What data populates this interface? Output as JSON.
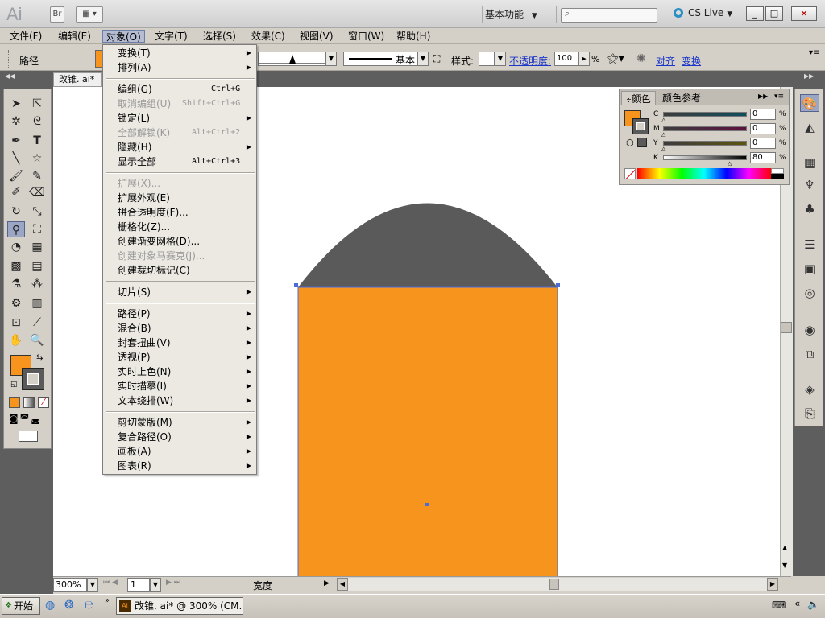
{
  "titlebar": {
    "app_logo": "Ai",
    "bridge_label": "Br",
    "workspace": "基本功能",
    "cs_live": "CS Live",
    "window_buttons": [
      "_",
      "□",
      "×"
    ]
  },
  "menubar": {
    "items": [
      "文件(F)",
      "编辑(E)",
      "对象(O)",
      "文字(T)",
      "选择(S)",
      "效果(C)",
      "视图(V)",
      "窗口(W)",
      "帮助(H)"
    ]
  },
  "controlbar": {
    "label": "路径",
    "stroke_profile": "基本",
    "style_label": "样式:",
    "opacity_label": "不透明度:",
    "opacity_value": "100",
    "opacity_unit": "%",
    "align_link": "对齐",
    "transform_link": "变换"
  },
  "document": {
    "tab": "改锥. ai*"
  },
  "object_menu": {
    "items": [
      {
        "label": "变换(T)",
        "shortcut": "",
        "submenu": true,
        "disabled": false
      },
      {
        "label": "排列(A)",
        "shortcut": "",
        "submenu": true,
        "disabled": false
      },
      {
        "label": "编组(G)",
        "shortcut": "Ctrl+G",
        "submenu": false,
        "disabled": false
      },
      {
        "label": "取消编组(U)",
        "shortcut": "Shift+Ctrl+G",
        "submenu": false,
        "disabled": true
      },
      {
        "label": "锁定(L)",
        "shortcut": "",
        "submenu": true,
        "disabled": false
      },
      {
        "label": "全部解锁(K)",
        "shortcut": "Alt+Ctrl+2",
        "submenu": false,
        "disabled": true
      },
      {
        "label": "隐藏(H)",
        "shortcut": "",
        "submenu": true,
        "disabled": false
      },
      {
        "label": "显示全部",
        "shortcut": "Alt+Ctrl+3",
        "submenu": false,
        "disabled": false
      },
      {
        "label": "扩展(X)...",
        "shortcut": "",
        "submenu": false,
        "disabled": true
      },
      {
        "label": "扩展外观(E)",
        "shortcut": "",
        "submenu": false,
        "disabled": false
      },
      {
        "label": "拼合透明度(F)...",
        "shortcut": "",
        "submenu": false,
        "disabled": false
      },
      {
        "label": "栅格化(Z)...",
        "shortcut": "",
        "submenu": false,
        "disabled": false
      },
      {
        "label": "创建渐变网格(D)...",
        "shortcut": "",
        "submenu": false,
        "disabled": false
      },
      {
        "label": "创建对象马赛克(J)...",
        "shortcut": "",
        "submenu": false,
        "disabled": true
      },
      {
        "label": "创建裁切标记(C)",
        "shortcut": "",
        "submenu": false,
        "disabled": false
      },
      {
        "label": "切片(S)",
        "shortcut": "",
        "submenu": true,
        "disabled": false
      },
      {
        "label": "路径(P)",
        "shortcut": "",
        "submenu": true,
        "disabled": false
      },
      {
        "label": "混合(B)",
        "shortcut": "",
        "submenu": true,
        "disabled": false
      },
      {
        "label": "封套扭曲(V)",
        "shortcut": "",
        "submenu": true,
        "disabled": false
      },
      {
        "label": "透视(P)",
        "shortcut": "",
        "submenu": true,
        "disabled": false
      },
      {
        "label": "实时上色(N)",
        "shortcut": "",
        "submenu": true,
        "disabled": false
      },
      {
        "label": "实时描摹(I)",
        "shortcut": "",
        "submenu": true,
        "disabled": false
      },
      {
        "label": "文本绕排(W)",
        "shortcut": "",
        "submenu": true,
        "disabled": false
      },
      {
        "label": "剪切蒙版(M)",
        "shortcut": "",
        "submenu": true,
        "disabled": false
      },
      {
        "label": "复合路径(O)",
        "shortcut": "",
        "submenu": true,
        "disabled": false
      },
      {
        "label": "画板(A)",
        "shortcut": "",
        "submenu": true,
        "disabled": false
      },
      {
        "label": "图表(R)",
        "shortcut": "",
        "submenu": true,
        "disabled": false
      }
    ]
  },
  "color_panel": {
    "tabs": [
      "颜色",
      "颜色参考"
    ],
    "channels": [
      {
        "name": "C",
        "value": "0",
        "unit": "%"
      },
      {
        "name": "M",
        "value": "0",
        "unit": "%"
      },
      {
        "name": "Y",
        "value": "0",
        "unit": "%"
      },
      {
        "name": "K",
        "value": "80",
        "unit": "%"
      }
    ],
    "fill_color": "#f7941e",
    "stroke_color": "#5a5a5a"
  },
  "artwork": {
    "body_color": "#f7941e",
    "cap_color": "#5a5a5a",
    "path_color": "#4b6bd6"
  },
  "statusbar": {
    "zoom": "300%",
    "artboard": "1",
    "info": "宽度"
  },
  "taskbar": {
    "start": "开始",
    "task_item": "改锥. ai* @ 300% (CM..."
  }
}
